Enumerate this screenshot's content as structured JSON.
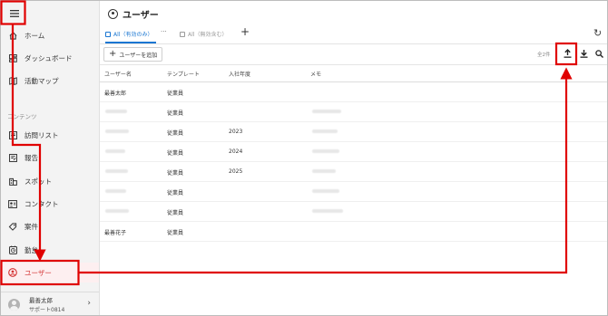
{
  "sidebar": {
    "items": [
      {
        "label": "ホーム",
        "icon": "home-icon"
      },
      {
        "label": "ダッシュボード",
        "icon": "dashboard-icon"
      },
      {
        "label": "活動マップ",
        "icon": "map-icon"
      },
      {
        "label": "訪問リスト",
        "icon": "list-icon"
      },
      {
        "label": "報告",
        "icon": "report-icon"
      },
      {
        "label": "スポット",
        "icon": "spot-icon"
      },
      {
        "label": "コンタクト",
        "icon": "contact-icon"
      },
      {
        "label": "案件",
        "icon": "deal-icon"
      },
      {
        "label": "勤怠",
        "icon": "attendance-icon"
      },
      {
        "label": "ユーザー",
        "icon": "user-icon"
      }
    ],
    "section_label": "コンテンツ",
    "user": {
      "name": "最善太郎",
      "sub": "サポート0814"
    }
  },
  "header": {
    "title": "ユーザー"
  },
  "tabs": [
    {
      "label": "All（有効のみ）"
    },
    {
      "label": "All（無効含む）"
    }
  ],
  "toolbar": {
    "add_label": "ユーザーを追加",
    "count_label": "全2件"
  },
  "table": {
    "headers": [
      "ユーザー名",
      "テンプレート",
      "入社年度",
      "メモ"
    ],
    "rows": [
      {
        "name": "最善太郎",
        "template": "従業員",
        "year": ""
      },
      {
        "name": "",
        "template": "従業員",
        "year": ""
      },
      {
        "name": "",
        "template": "従業員",
        "year": "2023"
      },
      {
        "name": "",
        "template": "従業員",
        "year": "2024"
      },
      {
        "name": "",
        "template": "従業員",
        "year": "2025"
      },
      {
        "name": "",
        "template": "従業員",
        "year": ""
      },
      {
        "name": "",
        "template": "従業員",
        "year": ""
      },
      {
        "name": "最善花子",
        "template": "従業員",
        "year": ""
      }
    ]
  },
  "colors": {
    "accent": "#d32f2f",
    "tab_active": "#1976d2",
    "annotation": "#e00000"
  }
}
